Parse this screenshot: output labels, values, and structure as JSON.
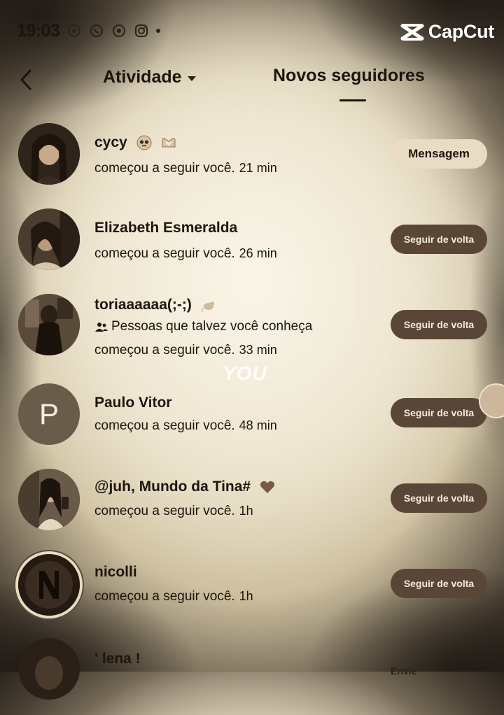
{
  "status_bar": {
    "time": "19:03",
    "icons": [
      "camera-icon",
      "whatsapp-icon",
      "camera-icon",
      "instagram-icon",
      "dot-icon"
    ]
  },
  "watermark": {
    "text": "CapCut",
    "icon": "capcut-logo-icon"
  },
  "header": {
    "back_icon": "back-arrow-icon",
    "tab_activity": "Atividade",
    "tab_new_followers": "Novos seguidores"
  },
  "followers": [
    {
      "name": "cycy",
      "status": "começou a seguir você.",
      "time": "21 min",
      "button": "Mensagem",
      "avatar": "photo"
    },
    {
      "name": "Elizabeth Esmeralda",
      "status": "começou a seguir você.",
      "time": "26 min",
      "button": "Seguir de volta",
      "avatar": "photo"
    },
    {
      "name": "toriaaaaaa(;-;)",
      "hint": "Pessoas que talvez você conheça",
      "status": "começou a seguir você.",
      "time": "33 min",
      "button": "Seguir de volta",
      "avatar": "photo"
    },
    {
      "name": "Paulo Vitor",
      "status": "começou a seguir você.",
      "time": "48 min",
      "button": "Seguir de volta",
      "avatar": "P"
    },
    {
      "name": "@juh, Mundo da Tina#",
      "status": "começou a seguir você.",
      "time": "1h",
      "button": "Seguir de volta",
      "avatar": "photo"
    },
    {
      "name": "nicolli",
      "status": "começou a seguir você.",
      "time": "1h",
      "button": "Seguir de volta",
      "avatar": "photo"
    },
    {
      "name": "' lena !",
      "button": "Envie",
      "avatar": "photo"
    }
  ],
  "overlay_text": "YOU",
  "colors": {
    "follow_button": "#5a4637",
    "message_button": "#eadcc4",
    "text": "#1d150d",
    "background": "#efe6cf"
  }
}
